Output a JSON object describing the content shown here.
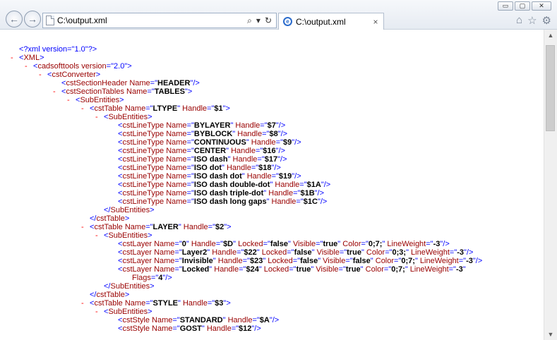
{
  "window": {
    "minimize": "▭",
    "restore": "▢",
    "close": "✕"
  },
  "nav": {
    "back": "←",
    "forward": "→"
  },
  "address": {
    "url": "C:\\output.xml",
    "search_icon": "⌕",
    "dropdown_icon": "▾",
    "refresh_icon": "↻"
  },
  "tab": {
    "title": "C:\\output.xml",
    "close": "×"
  },
  "toolbar": {
    "home": "⌂",
    "favorites": "☆",
    "tools": "⚙"
  },
  "scrollbar": {
    "up": "▲",
    "down": "▼"
  },
  "xml_lines": [
    {
      "indent": 0,
      "toggle": "",
      "segs": [
        [
          "pi",
          "<?xml version=\"1.0\"?>"
        ]
      ]
    },
    {
      "indent": 0,
      "toggle": "-",
      "segs": [
        [
          "bl",
          "<"
        ],
        [
          "tg",
          "XML"
        ],
        [
          "bl",
          ">"
        ]
      ]
    },
    {
      "indent": 1,
      "toggle": "-",
      "segs": [
        [
          "bl",
          "<"
        ],
        [
          "tg",
          "cadsofttools"
        ],
        [
          "an",
          " version"
        ],
        [
          "bl",
          "=\""
        ],
        [
          "pi",
          "2.0"
        ],
        [
          "bl",
          "\">"
        ]
      ]
    },
    {
      "indent": 2,
      "toggle": "-",
      "segs": [
        [
          "bl",
          "<"
        ],
        [
          "tg",
          "cstConverter"
        ],
        [
          "bl",
          ">"
        ]
      ]
    },
    {
      "indent": 3,
      "toggle": "",
      "segs": [
        [
          "bl",
          "<"
        ],
        [
          "tg",
          "cstSectionHeader"
        ],
        [
          "an",
          " Name"
        ],
        [
          "bl",
          "=\""
        ],
        [
          "av",
          "HEADER"
        ],
        [
          "bl",
          "\"/>"
        ]
      ]
    },
    {
      "indent": 3,
      "toggle": "-",
      "segs": [
        [
          "bl",
          "<"
        ],
        [
          "tg",
          "cstSectionTables"
        ],
        [
          "an",
          " Name"
        ],
        [
          "bl",
          "=\""
        ],
        [
          "av",
          "TABLES"
        ],
        [
          "bl",
          "\">"
        ]
      ]
    },
    {
      "indent": 4,
      "toggle": "-",
      "segs": [
        [
          "bl",
          "<"
        ],
        [
          "tg",
          "SubEntities"
        ],
        [
          "bl",
          ">"
        ]
      ]
    },
    {
      "indent": 5,
      "toggle": "-",
      "segs": [
        [
          "bl",
          "<"
        ],
        [
          "tg",
          "cstTable"
        ],
        [
          "an",
          " Name"
        ],
        [
          "bl",
          "=\""
        ],
        [
          "av",
          "LTYPE"
        ],
        [
          "bl",
          "\""
        ],
        [
          "an",
          " Handle"
        ],
        [
          "bl",
          "=\""
        ],
        [
          "av",
          "$1"
        ],
        [
          "bl",
          "\">"
        ]
      ]
    },
    {
      "indent": 6,
      "toggle": "-",
      "segs": [
        [
          "bl",
          "<"
        ],
        [
          "tg",
          "SubEntities"
        ],
        [
          "bl",
          ">"
        ]
      ]
    },
    {
      "indent": 7,
      "toggle": "",
      "segs": [
        [
          "bl",
          "<"
        ],
        [
          "tg",
          "cstLineType"
        ],
        [
          "an",
          " Name"
        ],
        [
          "bl",
          "=\""
        ],
        [
          "av",
          "BYLAYER"
        ],
        [
          "bl",
          "\""
        ],
        [
          "an",
          " Handle"
        ],
        [
          "bl",
          "=\""
        ],
        [
          "av",
          "$7"
        ],
        [
          "bl",
          "\"/>"
        ]
      ]
    },
    {
      "indent": 7,
      "toggle": "",
      "segs": [
        [
          "bl",
          "<"
        ],
        [
          "tg",
          "cstLineType"
        ],
        [
          "an",
          " Name"
        ],
        [
          "bl",
          "=\""
        ],
        [
          "av",
          "BYBLOCK"
        ],
        [
          "bl",
          "\""
        ],
        [
          "an",
          " Handle"
        ],
        [
          "bl",
          "=\""
        ],
        [
          "av",
          "$8"
        ],
        [
          "bl",
          "\"/>"
        ]
      ]
    },
    {
      "indent": 7,
      "toggle": "",
      "segs": [
        [
          "bl",
          "<"
        ],
        [
          "tg",
          "cstLineType"
        ],
        [
          "an",
          " Name"
        ],
        [
          "bl",
          "=\""
        ],
        [
          "av",
          "CONTINUOUS"
        ],
        [
          "bl",
          "\""
        ],
        [
          "an",
          " Handle"
        ],
        [
          "bl",
          "=\""
        ],
        [
          "av",
          "$9"
        ],
        [
          "bl",
          "\"/>"
        ]
      ]
    },
    {
      "indent": 7,
      "toggle": "",
      "segs": [
        [
          "bl",
          "<"
        ],
        [
          "tg",
          "cstLineType"
        ],
        [
          "an",
          " Name"
        ],
        [
          "bl",
          "=\""
        ],
        [
          "av",
          "CENTER"
        ],
        [
          "bl",
          "\""
        ],
        [
          "an",
          " Handle"
        ],
        [
          "bl",
          "=\""
        ],
        [
          "av",
          "$16"
        ],
        [
          "bl",
          "\"/>"
        ]
      ]
    },
    {
      "indent": 7,
      "toggle": "",
      "segs": [
        [
          "bl",
          "<"
        ],
        [
          "tg",
          "cstLineType"
        ],
        [
          "an",
          " Name"
        ],
        [
          "bl",
          "=\""
        ],
        [
          "av",
          "ISO dash"
        ],
        [
          "bl",
          "\""
        ],
        [
          "an",
          " Handle"
        ],
        [
          "bl",
          "=\""
        ],
        [
          "av",
          "$17"
        ],
        [
          "bl",
          "\"/>"
        ]
      ]
    },
    {
      "indent": 7,
      "toggle": "",
      "segs": [
        [
          "bl",
          "<"
        ],
        [
          "tg",
          "cstLineType"
        ],
        [
          "an",
          " Name"
        ],
        [
          "bl",
          "=\""
        ],
        [
          "av",
          "ISO dot"
        ],
        [
          "bl",
          "\""
        ],
        [
          "an",
          " Handle"
        ],
        [
          "bl",
          "=\""
        ],
        [
          "av",
          "$18"
        ],
        [
          "bl",
          "\"/>"
        ]
      ]
    },
    {
      "indent": 7,
      "toggle": "",
      "segs": [
        [
          "bl",
          "<"
        ],
        [
          "tg",
          "cstLineType"
        ],
        [
          "an",
          " Name"
        ],
        [
          "bl",
          "=\""
        ],
        [
          "av",
          "ISO dash dot"
        ],
        [
          "bl",
          "\""
        ],
        [
          "an",
          " Handle"
        ],
        [
          "bl",
          "=\""
        ],
        [
          "av",
          "$19"
        ],
        [
          "bl",
          "\"/>"
        ]
      ]
    },
    {
      "indent": 7,
      "toggle": "",
      "segs": [
        [
          "bl",
          "<"
        ],
        [
          "tg",
          "cstLineType"
        ],
        [
          "an",
          " Name"
        ],
        [
          "bl",
          "=\""
        ],
        [
          "av",
          "ISO dash double-dot"
        ],
        [
          "bl",
          "\""
        ],
        [
          "an",
          " Handle"
        ],
        [
          "bl",
          "=\""
        ],
        [
          "av",
          "$1A"
        ],
        [
          "bl",
          "\"/>"
        ]
      ]
    },
    {
      "indent": 7,
      "toggle": "",
      "segs": [
        [
          "bl",
          "<"
        ],
        [
          "tg",
          "cstLineType"
        ],
        [
          "an",
          " Name"
        ],
        [
          "bl",
          "=\""
        ],
        [
          "av",
          "ISO dash triple-dot"
        ],
        [
          "bl",
          "\""
        ],
        [
          "an",
          " Handle"
        ],
        [
          "bl",
          "=\""
        ],
        [
          "av",
          "$1B"
        ],
        [
          "bl",
          "\"/>"
        ]
      ]
    },
    {
      "indent": 7,
      "toggle": "",
      "segs": [
        [
          "bl",
          "<"
        ],
        [
          "tg",
          "cstLineType"
        ],
        [
          "an",
          " Name"
        ],
        [
          "bl",
          "=\""
        ],
        [
          "av",
          "ISO dash long gaps"
        ],
        [
          "bl",
          "\""
        ],
        [
          "an",
          " Handle"
        ],
        [
          "bl",
          "=\""
        ],
        [
          "av",
          "$1C"
        ],
        [
          "bl",
          "\"/>"
        ]
      ]
    },
    {
      "indent": 6,
      "toggle": "",
      "segs": [
        [
          "bl",
          "</"
        ],
        [
          "tg",
          "SubEntities"
        ],
        [
          "bl",
          ">"
        ]
      ]
    },
    {
      "indent": 5,
      "toggle": "",
      "segs": [
        [
          "bl",
          "</"
        ],
        [
          "tg",
          "cstTable"
        ],
        [
          "bl",
          ">"
        ]
      ]
    },
    {
      "indent": 5,
      "toggle": "-",
      "segs": [
        [
          "bl",
          "<"
        ],
        [
          "tg",
          "cstTable"
        ],
        [
          "an",
          " Name"
        ],
        [
          "bl",
          "=\""
        ],
        [
          "av",
          "LAYER"
        ],
        [
          "bl",
          "\""
        ],
        [
          "an",
          " Handle"
        ],
        [
          "bl",
          "=\""
        ],
        [
          "av",
          "$2"
        ],
        [
          "bl",
          "\">"
        ]
      ]
    },
    {
      "indent": 6,
      "toggle": "-",
      "segs": [
        [
          "bl",
          "<"
        ],
        [
          "tg",
          "SubEntities"
        ],
        [
          "bl",
          ">"
        ]
      ]
    },
    {
      "indent": 7,
      "toggle": "",
      "segs": [
        [
          "bl",
          "<"
        ],
        [
          "tg",
          "cstLayer"
        ],
        [
          "an",
          " Name"
        ],
        [
          "bl",
          "=\""
        ],
        [
          "av",
          "0"
        ],
        [
          "bl",
          "\""
        ],
        [
          "an",
          " Handle"
        ],
        [
          "bl",
          "=\""
        ],
        [
          "av",
          "$D"
        ],
        [
          "bl",
          "\""
        ],
        [
          "an",
          " Locked"
        ],
        [
          "bl",
          "=\""
        ],
        [
          "av",
          "false"
        ],
        [
          "bl",
          "\""
        ],
        [
          "an",
          " Visible"
        ],
        [
          "bl",
          "=\""
        ],
        [
          "av",
          "true"
        ],
        [
          "bl",
          "\""
        ],
        [
          "an",
          " Color"
        ],
        [
          "bl",
          "=\""
        ],
        [
          "av",
          "0;7;"
        ],
        [
          "bl",
          "\""
        ],
        [
          "an",
          " LineWeight"
        ],
        [
          "bl",
          "=\""
        ],
        [
          "av",
          "-3"
        ],
        [
          "bl",
          "\"/>"
        ]
      ]
    },
    {
      "indent": 7,
      "toggle": "",
      "segs": [
        [
          "bl",
          "<"
        ],
        [
          "tg",
          "cstLayer"
        ],
        [
          "an",
          " Name"
        ],
        [
          "bl",
          "=\""
        ],
        [
          "av",
          "Layer2"
        ],
        [
          "bl",
          "\""
        ],
        [
          "an",
          " Handle"
        ],
        [
          "bl",
          "=\""
        ],
        [
          "av",
          "$22"
        ],
        [
          "bl",
          "\""
        ],
        [
          "an",
          " Locked"
        ],
        [
          "bl",
          "=\""
        ],
        [
          "av",
          "false"
        ],
        [
          "bl",
          "\""
        ],
        [
          "an",
          " Visible"
        ],
        [
          "bl",
          "=\""
        ],
        [
          "av",
          "true"
        ],
        [
          "bl",
          "\""
        ],
        [
          "an",
          " Color"
        ],
        [
          "bl",
          "=\""
        ],
        [
          "av",
          "0;3;"
        ],
        [
          "bl",
          "\""
        ],
        [
          "an",
          " LineWeight"
        ],
        [
          "bl",
          "=\""
        ],
        [
          "av",
          "-3"
        ],
        [
          "bl",
          "\"/>"
        ]
      ]
    },
    {
      "indent": 7,
      "toggle": "",
      "segs": [
        [
          "bl",
          "<"
        ],
        [
          "tg",
          "cstLayer"
        ],
        [
          "an",
          " Name"
        ],
        [
          "bl",
          "=\""
        ],
        [
          "av",
          "Invisible"
        ],
        [
          "bl",
          "\""
        ],
        [
          "an",
          " Handle"
        ],
        [
          "bl",
          "=\""
        ],
        [
          "av",
          "$23"
        ],
        [
          "bl",
          "\""
        ],
        [
          "an",
          " Locked"
        ],
        [
          "bl",
          "=\""
        ],
        [
          "av",
          "false"
        ],
        [
          "bl",
          "\""
        ],
        [
          "an",
          " Visible"
        ],
        [
          "bl",
          "=\""
        ],
        [
          "av",
          "false"
        ],
        [
          "bl",
          "\""
        ],
        [
          "an",
          " Color"
        ],
        [
          "bl",
          "=\""
        ],
        [
          "av",
          "0;7;"
        ],
        [
          "bl",
          "\""
        ],
        [
          "an",
          " LineWeight"
        ],
        [
          "bl",
          "=\""
        ],
        [
          "av",
          "-3"
        ],
        [
          "bl",
          "\"/>"
        ]
      ]
    },
    {
      "indent": 7,
      "toggle": "",
      "segs": [
        [
          "bl",
          "<"
        ],
        [
          "tg",
          "cstLayer"
        ],
        [
          "an",
          " Name"
        ],
        [
          "bl",
          "=\""
        ],
        [
          "av",
          "Locked"
        ],
        [
          "bl",
          "\""
        ],
        [
          "an",
          " Handle"
        ],
        [
          "bl",
          "=\""
        ],
        [
          "av",
          "$24"
        ],
        [
          "bl",
          "\""
        ],
        [
          "an",
          " Locked"
        ],
        [
          "bl",
          "=\""
        ],
        [
          "av",
          "true"
        ],
        [
          "bl",
          "\""
        ],
        [
          "an",
          " Visible"
        ],
        [
          "bl",
          "=\""
        ],
        [
          "av",
          "true"
        ],
        [
          "bl",
          "\""
        ],
        [
          "an",
          " Color"
        ],
        [
          "bl",
          "=\""
        ],
        [
          "av",
          "0;7;"
        ],
        [
          "bl",
          "\""
        ],
        [
          "an",
          " LineWeight"
        ],
        [
          "bl",
          "=\""
        ],
        [
          "av",
          "-3"
        ],
        [
          "bl",
          "\""
        ]
      ]
    },
    {
      "indent": 8,
      "toggle": "",
      "segs": [
        [
          "an",
          "Flags"
        ],
        [
          "bl",
          "=\""
        ],
        [
          "av",
          "4"
        ],
        [
          "bl",
          "\"/>"
        ]
      ]
    },
    {
      "indent": 6,
      "toggle": "",
      "segs": [
        [
          "bl",
          "</"
        ],
        [
          "tg",
          "SubEntities"
        ],
        [
          "bl",
          ">"
        ]
      ]
    },
    {
      "indent": 5,
      "toggle": "",
      "segs": [
        [
          "bl",
          "</"
        ],
        [
          "tg",
          "cstTable"
        ],
        [
          "bl",
          ">"
        ]
      ]
    },
    {
      "indent": 5,
      "toggle": "-",
      "segs": [
        [
          "bl",
          "<"
        ],
        [
          "tg",
          "cstTable"
        ],
        [
          "an",
          " Name"
        ],
        [
          "bl",
          "=\""
        ],
        [
          "av",
          "STYLE"
        ],
        [
          "bl",
          "\""
        ],
        [
          "an",
          " Handle"
        ],
        [
          "bl",
          "=\""
        ],
        [
          "av",
          "$3"
        ],
        [
          "bl",
          "\">"
        ]
      ]
    },
    {
      "indent": 6,
      "toggle": "-",
      "segs": [
        [
          "bl",
          "<"
        ],
        [
          "tg",
          "SubEntities"
        ],
        [
          "bl",
          ">"
        ]
      ]
    },
    {
      "indent": 7,
      "toggle": "",
      "segs": [
        [
          "bl",
          "<"
        ],
        [
          "tg",
          "cstStyle"
        ],
        [
          "an",
          " Name"
        ],
        [
          "bl",
          "=\""
        ],
        [
          "av",
          "STANDARD"
        ],
        [
          "bl",
          "\""
        ],
        [
          "an",
          " Handle"
        ],
        [
          "bl",
          "=\""
        ],
        [
          "av",
          "$A"
        ],
        [
          "bl",
          "\"/>"
        ]
      ]
    },
    {
      "indent": 7,
      "toggle": "",
      "segs": [
        [
          "bl",
          "<"
        ],
        [
          "tg",
          "cstStyle"
        ],
        [
          "an",
          " Name"
        ],
        [
          "bl",
          "=\""
        ],
        [
          "av",
          "GOST"
        ],
        [
          "bl",
          "\""
        ],
        [
          "an",
          " Handle"
        ],
        [
          "bl",
          "=\""
        ],
        [
          "av",
          "$12"
        ],
        [
          "bl",
          "\"/>"
        ]
      ]
    }
  ]
}
